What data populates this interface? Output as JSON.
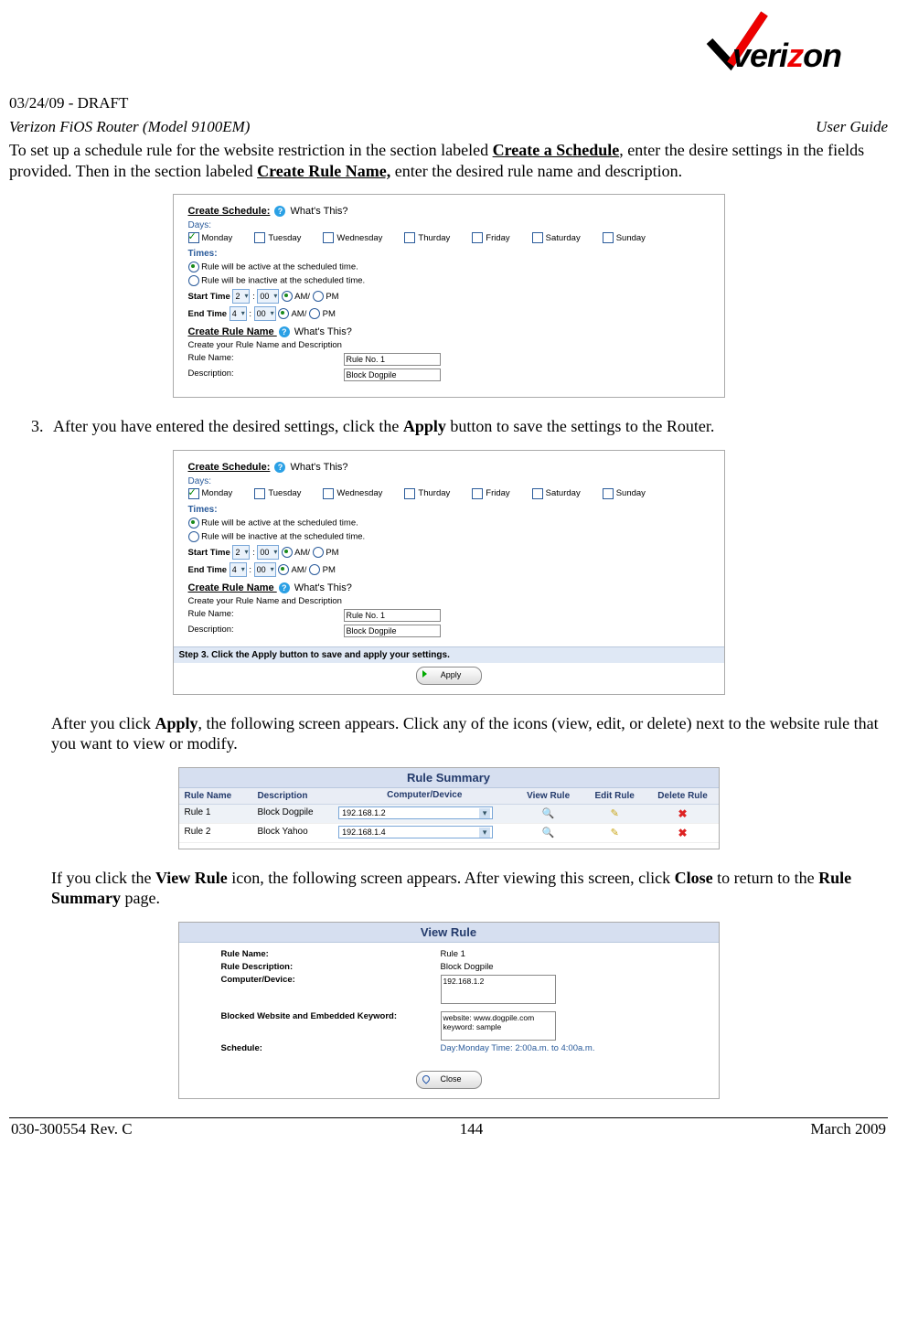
{
  "header": {
    "draft": "03/24/09 - DRAFT",
    "left": "Verizon FiOS Router (Model 9100EM)",
    "right": "User Guide",
    "logo_text_pre": "veri",
    "logo_text_z": "z",
    "logo_text_post": "on"
  },
  "intro": {
    "pre": "To set up a schedule rule for the website restriction in the section labeled ",
    "b1": "Create a Schedule",
    "mid1": ", enter the desire settings in the fields provided. Then in the section labeled ",
    "b2": "Create Rule Name,",
    "post": " enter the desired rule name and description."
  },
  "shot_common": {
    "create_schedule": "Create Schedule:",
    "whats_this": "What's This?",
    "days_label": "Days:",
    "days": [
      "Monday",
      "Tuesday",
      "Wednesday",
      "Thurday",
      "Friday",
      "Saturday",
      "Sunday"
    ],
    "times_label": "Times:",
    "rule_active": "Rule will be active at the scheduled time.",
    "rule_inactive": "Rule will be inactive at the scheduled time.",
    "start_time": "Start Time",
    "end_time": "End Time",
    "hr2": "2",
    "hr4": "4",
    "min00": "00",
    "am": "AM/",
    "pm": "PM",
    "create_rule_name": "Create Rule Name ",
    "create_desc_line": "Create your Rule Name and Description",
    "rule_name_k": "Rule Name:",
    "rule_name_v": "Rule No. 1",
    "desc_k": "Description:",
    "desc_v": "Block Dogpile"
  },
  "step3_list": {
    "num": "3.",
    "pre": "After you have entered the desired settings, click the ",
    "b": "Apply",
    "post": " button to save the settings to the Router."
  },
  "shot2": {
    "step3": "Step 3. Click the Apply button to save and apply your settings.",
    "apply": "Apply"
  },
  "after_apply": {
    "pre": "After you click ",
    "b": "Apply",
    "post": ", the following screen appears. Click any of the icons (view, edit, or delete) next to the website rule that you want to view or modify."
  },
  "rule_summary": {
    "title": "Rule Summary",
    "cols": [
      "Rule Name",
      "Description",
      "Computer/Device",
      "View Rule",
      "Edit Rule",
      "Delete Rule"
    ],
    "rows": [
      {
        "name": "Rule 1",
        "desc": "Block Dogpile",
        "ip": "192.168.1.2"
      },
      {
        "name": "Rule 2",
        "desc": "Block Yahoo",
        "ip": "192.168.1.4"
      }
    ]
  },
  "view_rule_para": {
    "p1": "If you click the ",
    "b1": "View Rule",
    "p2": " icon, the following screen appears. After viewing this screen, click ",
    "b2": "Close",
    "p3": " to return to the ",
    "b3": "Rule Summary",
    "p4": " page."
  },
  "view_rule": {
    "title": "View Rule",
    "k_name": "Rule Name:",
    "v_name": "Rule 1",
    "k_desc": "Rule Description:",
    "v_desc": "Block Dogpile",
    "k_cd": "Computer/Device:",
    "v_cd": "192.168.1.2",
    "k_bw": "Blocked Website and Embedded Keyword:",
    "v_bw": "website: www.dogpile.com\nkeyword: sample",
    "k_sched": "Schedule:",
    "v_sched": "Day:Monday Time: 2:00a.m. to 4:00a.m.",
    "close": "Close"
  },
  "footer": {
    "left": "030-300554 Rev. C",
    "mid": "144",
    "right": "March 2009"
  }
}
